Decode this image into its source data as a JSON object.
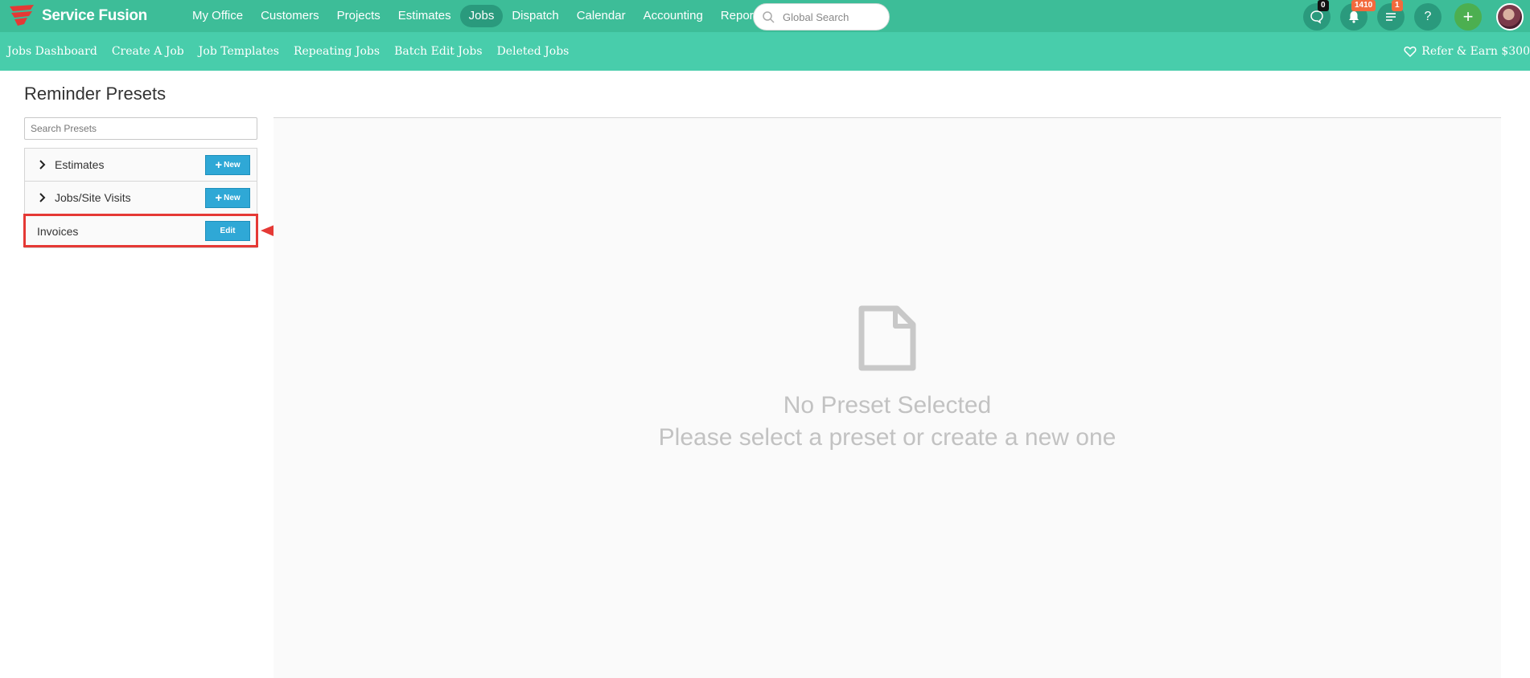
{
  "app": {
    "name": "Service Fusion"
  },
  "topnav": {
    "items": [
      {
        "label": "My Office"
      },
      {
        "label": "Customers"
      },
      {
        "label": "Projects"
      },
      {
        "label": "Estimates"
      },
      {
        "label": "Jobs",
        "active": true
      },
      {
        "label": "Dispatch"
      },
      {
        "label": "Calendar"
      },
      {
        "label": "Accounting"
      },
      {
        "label": "Reports"
      }
    ],
    "search_placeholder": "Global Search",
    "chat_count": "0",
    "notification_count": "1410",
    "task_count": "1",
    "help_label": "?",
    "add_label": "+"
  },
  "subnav": {
    "items": [
      {
        "label": "Jobs Dashboard"
      },
      {
        "label": "Create A Job"
      },
      {
        "label": "Job Templates"
      },
      {
        "label": "Repeating Jobs"
      },
      {
        "label": "Batch Edit Jobs"
      },
      {
        "label": "Deleted Jobs"
      }
    ],
    "refer_label": "Refer & Earn $300"
  },
  "page": {
    "title": "Reminder Presets",
    "search_placeholder": "Search Presets",
    "presets": [
      {
        "label": "Estimates",
        "button": "New",
        "expandable": true
      },
      {
        "label": "Jobs/Site Visits",
        "button": "New",
        "expandable": true
      },
      {
        "label": "Invoices",
        "button": "Edit",
        "expandable": false
      }
    ],
    "empty_title": "No Preset Selected",
    "empty_sub": "Please select a preset or create a new one"
  },
  "colors": {
    "topbar": "#3dbd98",
    "subbar": "#48cdab",
    "button": "#2fa8d6",
    "highlight": "#e53935"
  }
}
